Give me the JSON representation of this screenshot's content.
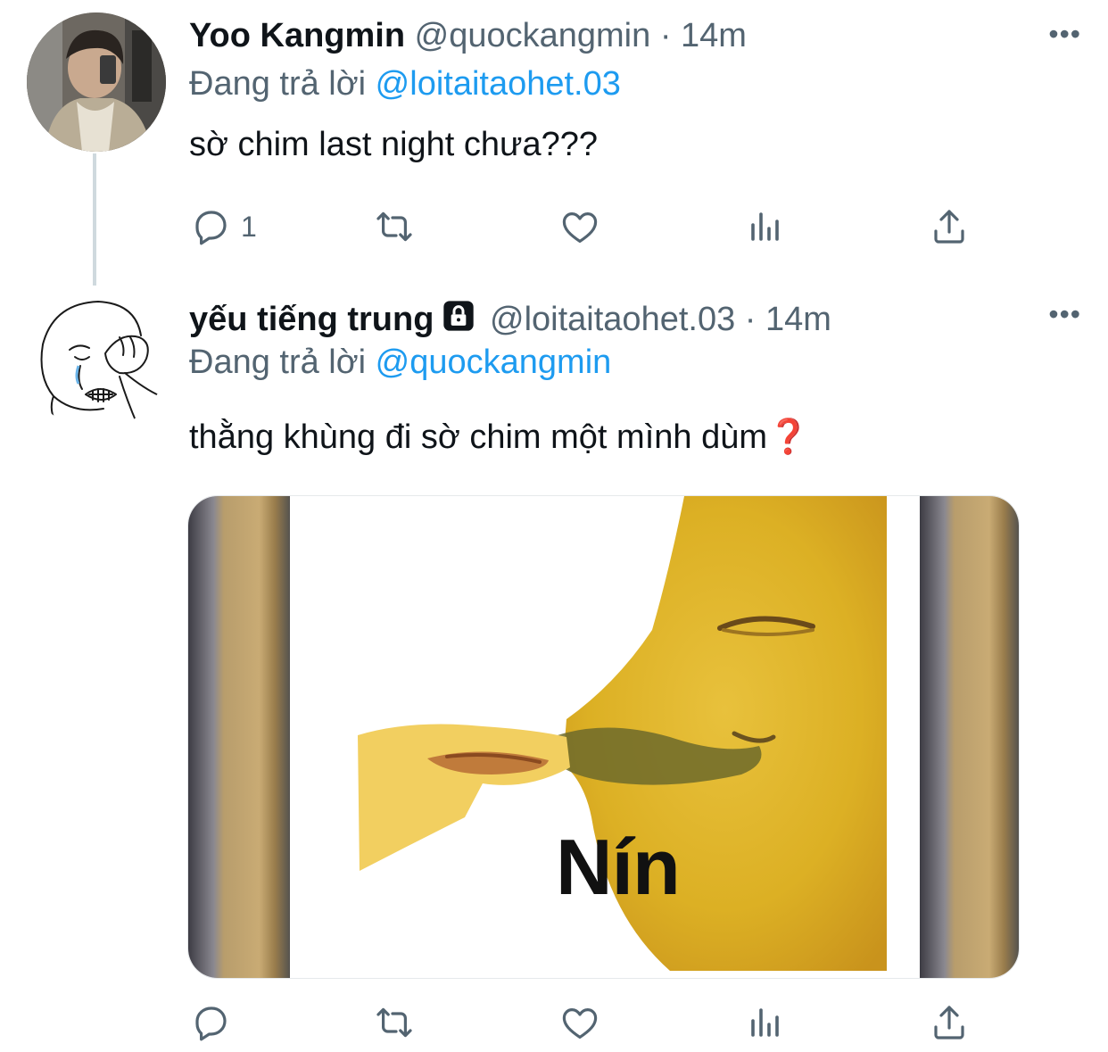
{
  "tweets": [
    {
      "author_name": "Yoo Kangmin",
      "handle": "@quockangmin",
      "separator": "·",
      "time": "14m",
      "reply_label": "Đang trả lời",
      "reply_to": "@loitaitaohet.03",
      "text": "sờ chim last night chưa???",
      "reply_count": "1",
      "more": "•••"
    },
    {
      "author_name": "yếu tiếng trung",
      "locked": true,
      "handle": "@loitaitaohet.03",
      "separator": "·",
      "time": "14m",
      "reply_label": "Đang trả lời",
      "reply_to": "@quockangmin",
      "text": "thằng khùng đi sờ chim một mình dùm",
      "text_emoji": "❓",
      "media_caption": "Nín",
      "reply_count": "",
      "more": "•••"
    }
  ],
  "icons": [
    "reply-icon",
    "retweet-icon",
    "like-icon",
    "stats-icon",
    "share-icon",
    "lock-icon",
    "more-icon"
  ],
  "colors": {
    "link": "#1d9bf0",
    "secondary": "#536471",
    "text": "#0f1419",
    "thread_line": "#cfd9de"
  }
}
